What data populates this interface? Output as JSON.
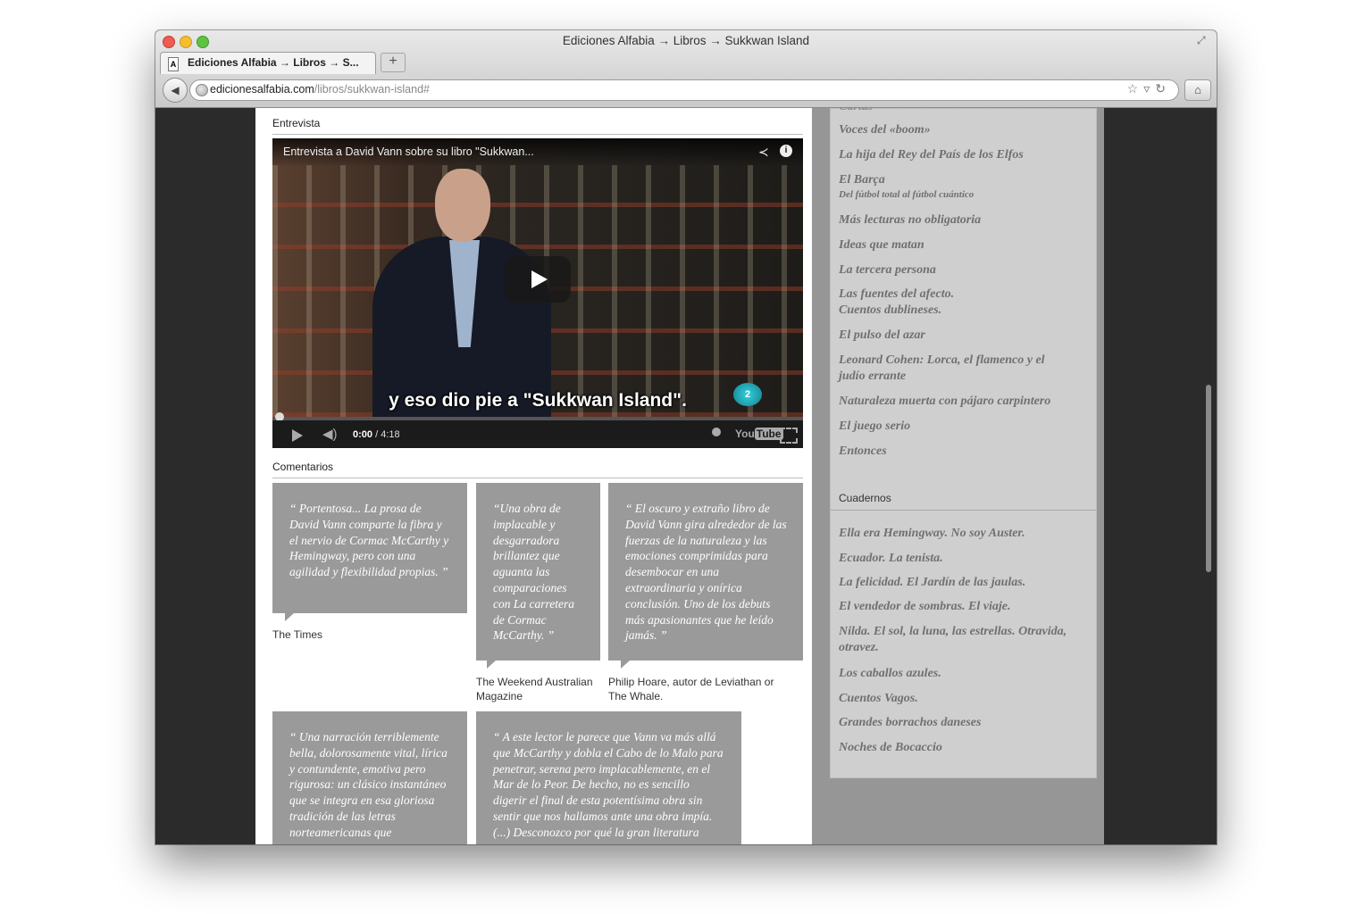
{
  "browser": {
    "window_title": "Ediciones Alfabia → Libros → Sukkwan Island",
    "tab_label": "Ediciones Alfabia → Libros → S...",
    "new_tab_label": "+",
    "url_domain": "edicionesalfabia.com",
    "url_path": "/libros/sukkwan-island#"
  },
  "main": {
    "interview_heading": "Entrevista",
    "video": {
      "title": "Entrevista a David Vann sobre su libro \"Sukkwan...",
      "subtitle": "y eso dio pie a \"Sukkwan Island\".",
      "channel_logo": "2",
      "time_current": "0:00",
      "time_total": " / 4:18",
      "youtube_label": "You",
      "youtube_tube": "Tube",
      "progress": 0
    },
    "comments_heading": "Comentarios",
    "comments": [
      {
        "quote": "“ Portentosa... La prosa de David Vann comparte la fibra y el nervio de Cormac McCarthy y Hemingway, pero con una agilidad y flexibilidad propias. ”",
        "source": "The Times"
      },
      {
        "quote": "“Una obra de implacable y desgarradora brillantez que aguanta las comparaciones con La carretera de Cormac McCarthy. ”",
        "source": "The Weekend Australian Magazine"
      },
      {
        "quote": "“ El oscuro y extraño libro de David Vann gira alrededor de las fuerzas de la naturaleza y las emociones comprimidas para desembocar en una extraordinaria y onírica conclusión. Uno de los debuts más apasionantes que he leído jamás. ”",
        "source": "Philip Hoare, autor de Leviathan or The Whale."
      },
      {
        "quote": "“ Una narración terriblemente bella, dolorosamente vital, lírica y contundente, emotiva pero rigurosa: un clásico instantáneo que se integra en esa gloriosa tradición de las letras norteamericanas que",
        "source": ""
      },
      {
        "quote": "“ A este lector le parece que Vann va más allá que McCarthy y dobla el Cabo de lo Malo para penetrar, serena pero implacablemente, en el Mar de lo Peor. De hecho, no es sencillo digerir el final de esta potentísima obra sin sentir que nos hallamos ante una obra impía. (...) Desconozco por qué la gran literatura",
        "source": ""
      }
    ]
  },
  "sidebar": {
    "cut_off_item": "Cartas",
    "books": [
      {
        "title": "Voces del «boom»",
        "sub": ""
      },
      {
        "title": "La hija del Rey del País de los Elfos",
        "sub": ""
      },
      {
        "title": "El Barça",
        "sub": "Del fútbol total al fútbol cuántico"
      },
      {
        "title": "Más lecturas no obligatoria",
        "sub": ""
      },
      {
        "title": "Ideas que matan",
        "sub": ""
      },
      {
        "title": "La tercera persona",
        "sub": ""
      },
      {
        "title": "Las fuentes del afecto.",
        "sub2": "Cuentos dublineses."
      },
      {
        "title": "El pulso del azar",
        "sub": ""
      },
      {
        "title": "Leonard Cohen: Lorca, el flamenco y el",
        "sub2": "judío errante"
      },
      {
        "title": "Naturaleza muerta con pájaro carpintero",
        "sub": ""
      },
      {
        "title": "El juego serio",
        "sub": ""
      },
      {
        "title": "Entonces",
        "sub": ""
      }
    ],
    "cuadernos_heading": "Cuadernos",
    "cuadernos": [
      {
        "title": "Ella era Hemingway. No soy Auster."
      },
      {
        "title": "Ecuador. La tenista."
      },
      {
        "title": "La felicidad. El Jardín de las jaulas."
      },
      {
        "title": "El vendedor de sombras. El viaje."
      },
      {
        "title": "Nilda. El sol, la luna, las estrellas. Otravida,",
        "sub2": "otravez."
      },
      {
        "title": "Los caballos azules."
      },
      {
        "title": "Cuentos Vagos."
      },
      {
        "title": "Grandes borrachos daneses"
      },
      {
        "title": "Noches de Bocaccio"
      }
    ]
  }
}
